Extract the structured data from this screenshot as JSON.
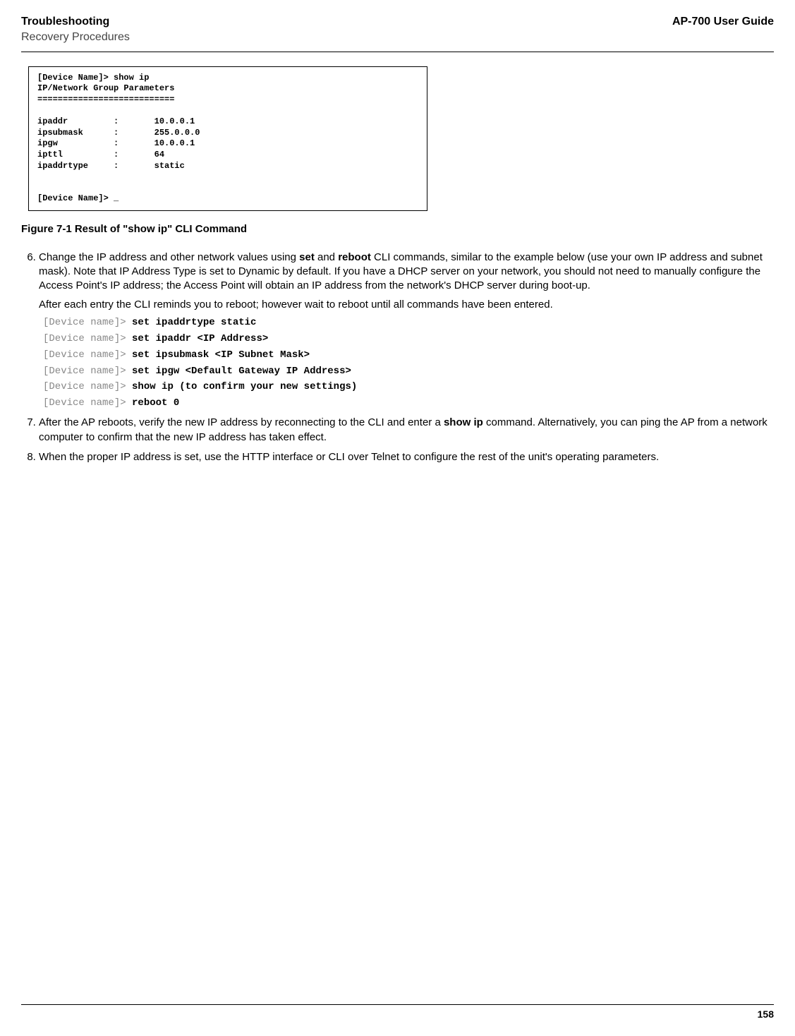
{
  "header": {
    "title": "Troubleshooting",
    "subtitle": "Recovery Procedures",
    "guide": "AP-700 User Guide"
  },
  "terminal": {
    "line1": "[Device Name]> show ip",
    "line2": "IP/Network Group Parameters",
    "line3": "===========================",
    "line4": "",
    "line5": "ipaddr         :       10.0.0.1",
    "line6": "ipsubmask      :       255.0.0.0",
    "line7": "ipgw           :       10.0.0.1",
    "line8": "ipttl          :       64",
    "line9": "ipaddrtype     :       static",
    "line10": "",
    "line11": "",
    "line12": "[Device Name]> _"
  },
  "figure_caption": "Figure 7-1 Result of \"show ip\" CLI Command",
  "steps": {
    "six": {
      "main_a": "Change the IP address and other network values using ",
      "bold_set": "set",
      "main_b": " and ",
      "bold_reboot": "reboot",
      "main_c": " CLI commands, similar to the example below (use your own IP address and subnet mask). Note that IP Address Type is set to Dynamic by default. If you have a DHCP server on your network, you should not need to manually configure the Access Point's IP address; the Access Point will obtain an IP address from the network's DHCP server during boot-up.",
      "sub": "After each entry the CLI reminds you to reboot; however wait to reboot until all commands have been entered.",
      "codes": [
        {
          "prompt": "[Device name]>",
          "cmd": "set ipaddrtype static"
        },
        {
          "prompt": "[Device name]>",
          "cmd": " set ipaddr <IP Address>"
        },
        {
          "prompt": "[Device name]>",
          "cmd": "set ipsubmask <IP Subnet Mask>"
        },
        {
          "prompt": "[Device name]>",
          "cmd": "set ipgw <Default Gateway IP Address>"
        },
        {
          "prompt": "[Device name]>",
          "cmd": "show ip (to confirm your new settings)"
        },
        {
          "prompt": "[Device name]>",
          "cmd": "reboot 0"
        }
      ]
    },
    "seven_a": "After the AP reboots, verify the new IP address by reconnecting to the CLI and enter a ",
    "seven_bold": "show ip",
    "seven_b": " command. Alternatively, you can ping the AP from a network computer to confirm that the new IP address has taken effect.",
    "eight": "When the proper IP address is set, use the HTTP interface or CLI over Telnet to configure the rest of the unit's operating parameters."
  },
  "footer": {
    "page": "158"
  }
}
